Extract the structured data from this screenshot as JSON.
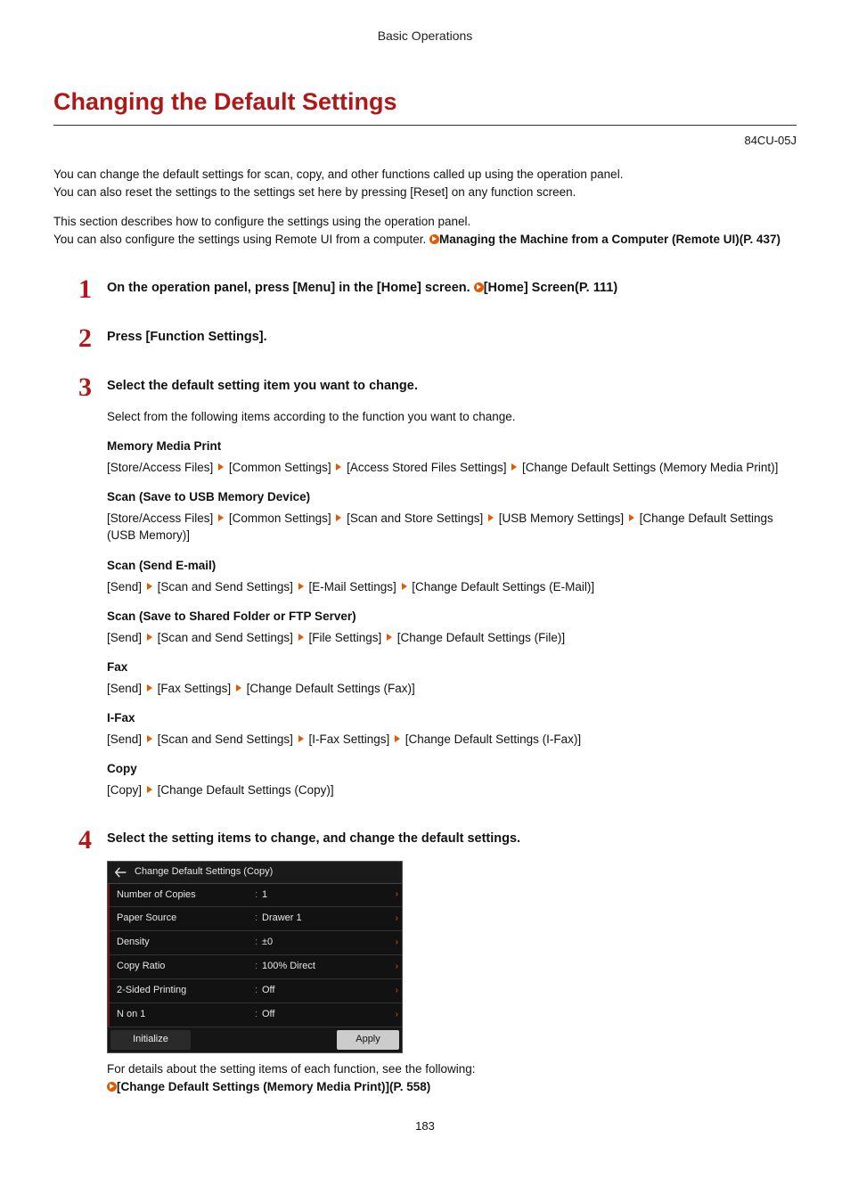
{
  "header": {
    "section": "Basic Operations"
  },
  "title": "Changing the Default Settings",
  "doc_code": "84CU-05J",
  "intro": {
    "p1a": "You can change the default settings for scan, copy, and other functions called up using the operation panel.",
    "p1b": "You can also reset the settings to the settings set here by pressing [Reset] on any function screen.",
    "p2a": "This section describes how to configure the settings using the operation panel.",
    "p2b": "You can also configure the settings using Remote UI from a computer. ",
    "xref1": "Managing the Machine from a Computer (Remote UI)(P. 437)"
  },
  "steps": {
    "s1": {
      "num": "1",
      "title_a": "On the operation panel, press [Menu] in the [Home] screen. ",
      "xref": "[Home] Screen(P. 111)"
    },
    "s2": {
      "num": "2",
      "title": "Press [Function Settings]."
    },
    "s3": {
      "num": "3",
      "title": "Select the default setting item you want to change.",
      "lead": "Select from the following items according to the function you want to change.",
      "groups": {
        "g1": {
          "h": "Memory Media Print",
          "parts": [
            "[Store/Access Files]",
            "[Common Settings]",
            "[Access Stored Files Settings]",
            "[Change Default Settings (Memory Media Print)]"
          ]
        },
        "g2": {
          "h": "Scan (Save to USB Memory Device)",
          "parts": [
            "[Store/Access Files]",
            "[Common Settings]",
            "[Scan and Store Settings]",
            "[USB Memory Settings]",
            "[Change Default Settings (USB Memory)]"
          ]
        },
        "g3": {
          "h": "Scan (Send E-mail)",
          "parts": [
            "[Send]",
            "[Scan and Send Settings]",
            "[E-Mail Settings]",
            "[Change Default Settings (E-Mail)]"
          ]
        },
        "g4": {
          "h": "Scan (Save to Shared Folder or FTP Server)",
          "parts": [
            "[Send]",
            "[Scan and Send Settings]",
            "[File Settings]",
            "[Change Default Settings (File)]"
          ]
        },
        "g5": {
          "h": "Fax",
          "parts": [
            "[Send]",
            "[Fax Settings]",
            "[Change Default Settings (Fax)]"
          ]
        },
        "g6": {
          "h": "I-Fax",
          "parts": [
            "[Send]",
            "[Scan and Send Settings]",
            "[I-Fax Settings]",
            "[Change Default Settings (I-Fax)]"
          ]
        },
        "g7": {
          "h": "Copy",
          "parts": [
            "[Copy]",
            "[Change Default Settings (Copy)]"
          ]
        }
      }
    },
    "s4": {
      "num": "4",
      "title": "Select the setting items to change, and change the default settings.",
      "screenshot": {
        "title": "Change Default Settings (Copy)",
        "rows": [
          {
            "label": "Number of Copies",
            "value": "1"
          },
          {
            "label": "Paper Source",
            "value": "Drawer 1"
          },
          {
            "label": "Density",
            "value": "±0"
          },
          {
            "label": "Copy Ratio",
            "value": "100% Direct"
          },
          {
            "label": "2-Sided Printing",
            "value": "Off"
          },
          {
            "label": "N on 1",
            "value": "Off"
          }
        ],
        "buttons": {
          "initialize": "Initialize",
          "apply": "Apply"
        }
      },
      "footnote_a": "For details about the setting items of each function, see the following:",
      "xref": "[Change Default Settings (Memory Media Print)](P. 558)"
    }
  },
  "page_number": "183"
}
